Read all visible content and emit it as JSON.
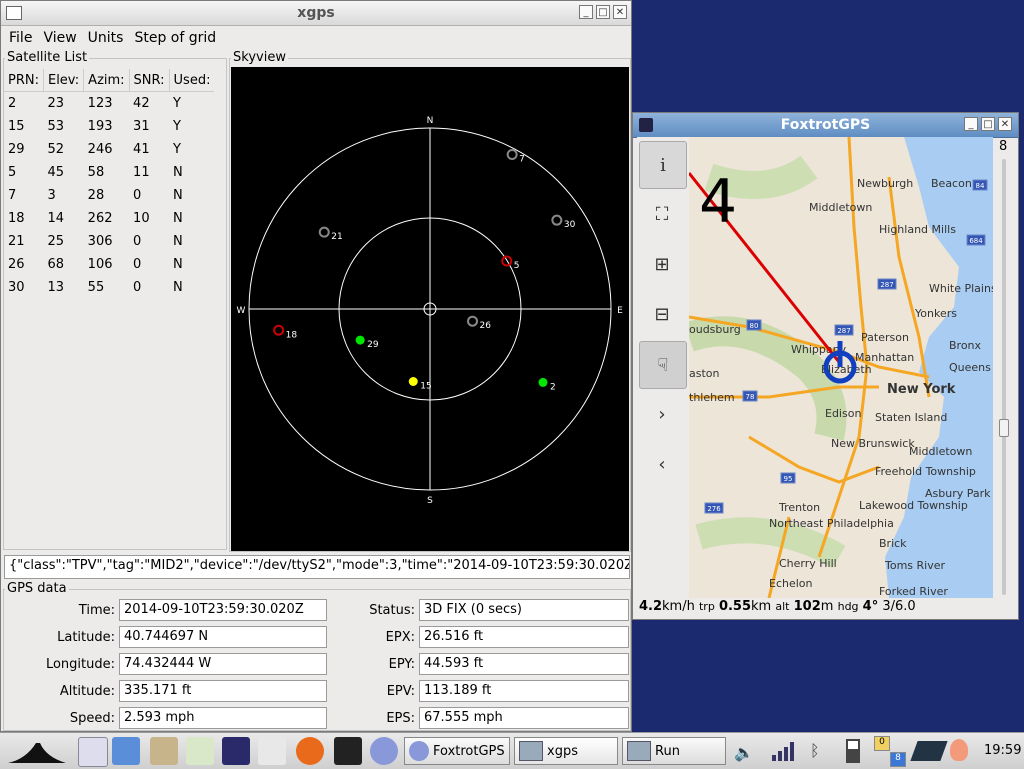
{
  "xgps": {
    "title": "xgps",
    "menu": [
      "File",
      "View",
      "Units",
      "Step of grid"
    ],
    "sat_list_label": "Satellite List",
    "skyview_label": "Skyview",
    "columns": [
      "PRN:",
      "Elev:",
      "Azim:",
      "SNR:",
      "Used:"
    ],
    "rows": [
      [
        "2",
        "23",
        "123",
        "42",
        "Y"
      ],
      [
        "15",
        "53",
        "193",
        "31",
        "Y"
      ],
      [
        "29",
        "52",
        "246",
        "41",
        "Y"
      ],
      [
        "5",
        "45",
        "58",
        "11",
        "N"
      ],
      [
        "7",
        "3",
        "28",
        "0",
        "N"
      ],
      [
        "18",
        "14",
        "262",
        "10",
        "N"
      ],
      [
        "21",
        "25",
        "306",
        "0",
        "N"
      ],
      [
        "26",
        "68",
        "106",
        "0",
        "N"
      ],
      [
        "30",
        "13",
        "55",
        "0",
        "N"
      ]
    ],
    "compass": {
      "n": "N",
      "s": "S",
      "e": "E",
      "w": "W"
    },
    "sky_sats": [
      {
        "prn": "7",
        "state": "none"
      },
      {
        "prn": "30",
        "state": "none"
      },
      {
        "prn": "21",
        "state": "none"
      },
      {
        "prn": "5",
        "state": "weak"
      },
      {
        "prn": "26",
        "state": "none"
      },
      {
        "prn": "18",
        "state": "weak"
      },
      {
        "prn": "29",
        "state": "used"
      },
      {
        "prn": "15",
        "state": "used-yellow"
      },
      {
        "prn": "2",
        "state": "used"
      }
    ],
    "json_line": "{\"class\":\"TPV\",\"tag\":\"MID2\",\"device\":\"/dev/ttyS2\",\"mode\":3,\"time\":\"2014-09-10T23:59:30.020Z",
    "gps_label": "GPS data",
    "left_fields": [
      {
        "label": "Time:",
        "value": "2014-09-10T23:59:30.020Z"
      },
      {
        "label": "Latitude:",
        "value": "40.744697 N"
      },
      {
        "label": "Longitude:",
        "value": "74.432444 W"
      },
      {
        "label": "Altitude:",
        "value": "335.171 ft"
      },
      {
        "label": "Speed:",
        "value": "2.593 mph"
      }
    ],
    "right_fields": [
      {
        "label": "Status:",
        "value": "3D FIX (0 secs)"
      },
      {
        "label": "EPX:",
        "value": "26.516 ft"
      },
      {
        "label": "EPY:",
        "value": "44.593 ft"
      },
      {
        "label": "EPV:",
        "value": "113.189 ft"
      },
      {
        "label": "EPS:",
        "value": "67.555 mph"
      }
    ]
  },
  "foxtrot": {
    "title": "FoxtrotGPS",
    "zoom": "8",
    "big_number": "4",
    "status": {
      "speed": "4.2",
      "speed_unit": "km/h",
      "trp_label": "trp",
      "trip": "0.55",
      "trip_unit": "km",
      "alt_label": "alt",
      "alt": "102",
      "alt_unit": "m",
      "hdg_label": "hdg",
      "hdg": "4°",
      "sats": "3/6.0"
    },
    "map_labels": [
      "Newburgh",
      "Beacon",
      "Middletown",
      "Highland Mills",
      "White Plains",
      "Yonkers",
      "Paterson",
      "Bronx",
      "Manhattan",
      "Queens",
      "Elizabeth",
      "New York",
      "Whippany",
      "Edison",
      "Staten Island",
      "New Brunswick",
      "Middletown",
      "Freehold Township",
      "Asbury Park",
      "Lakewood Township",
      "Trenton",
      "Northeast Philadelphia",
      "Brick",
      "Toms River",
      "Cherry Hill",
      "Echelon",
      "Forked River",
      "oudsburg",
      "aston",
      "thlehem"
    ],
    "highways": [
      "84",
      "684",
      "287",
      "80",
      "287",
      "78",
      "95",
      "276"
    ]
  },
  "taskbar": {
    "tasks": [
      "FoxtrotGPS",
      "xgps",
      "Run"
    ],
    "clock": "19:59",
    "kb_top": "0",
    "kb_bottom": "8"
  },
  "colors": {
    "used": "#00e600",
    "yellow": "#ffff00",
    "weak": "#cc0000",
    "none": "#888888",
    "track": "#dd0000",
    "gpsblue": "#1040c0"
  }
}
